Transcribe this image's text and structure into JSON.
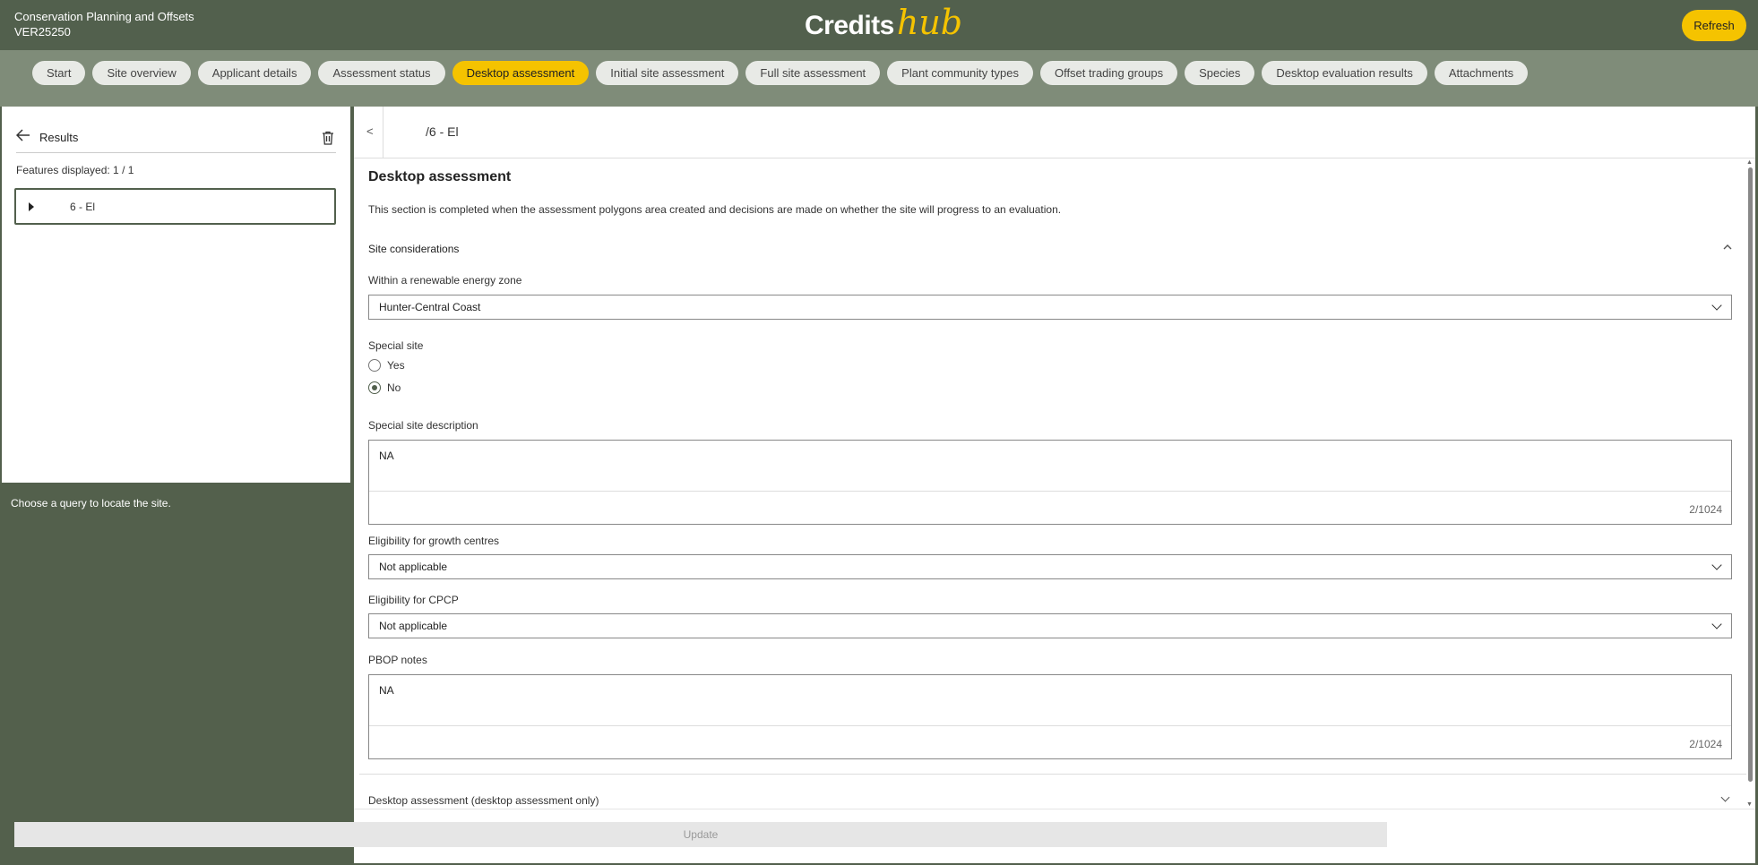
{
  "header": {
    "app_name": "Conservation Planning and Offsets",
    "record_id": "VER25250",
    "logo_credits": "Credits",
    "logo_hub": "hub",
    "refresh_label": "Refresh"
  },
  "tabs": [
    {
      "label": "Start",
      "active": false
    },
    {
      "label": "Site overview",
      "active": false
    },
    {
      "label": "Applicant details",
      "active": false
    },
    {
      "label": "Assessment status",
      "active": false
    },
    {
      "label": "Desktop assessment",
      "active": true
    },
    {
      "label": "Initial site assessment",
      "active": false
    },
    {
      "label": "Full site assessment",
      "active": false
    },
    {
      "label": "Plant community types",
      "active": false
    },
    {
      "label": "Offset trading groups",
      "active": false
    },
    {
      "label": "Species",
      "active": false
    },
    {
      "label": "Desktop evaluation results",
      "active": false
    },
    {
      "label": "Attachments",
      "active": false
    }
  ],
  "left_panel": {
    "results_label": "Results",
    "back_icon": "arrow-left-icon",
    "trash_icon": "trash-icon",
    "features_displayed": "Features displayed: 1 / 1",
    "feature_label": "6 - El",
    "note": "Choose a query to locate the site."
  },
  "main": {
    "back_label": "<",
    "top_title": "/6 - El",
    "section_title": "Desktop assessment",
    "section_desc": "This section is completed when the assessment polygons area created and decisions are made on whether the site will progress to an evaluation.",
    "site_considerations": "Site considerations",
    "renewable_label": "Within a renewable energy zone",
    "renewable_value": "Hunter-Central Coast",
    "special_site_label": "Special site",
    "radio_yes": "Yes",
    "radio_no": "No",
    "special_site_selected": "No",
    "special_desc_label": "Special site description",
    "special_desc_value": "NA",
    "special_desc_counter": "2/1024",
    "growth_label": "Eligibility for growth centres",
    "growth_value": "Not applicable",
    "cpcp_label": "Eligibility for CPCP",
    "cpcp_value": "Not applicable",
    "pbop_label": "PBOP notes",
    "pbop_value": "NA",
    "pbop_counter": "2/1024",
    "desktop_only": "Desktop assessment (desktop assessment only)",
    "update_label": "Update"
  },
  "colors": {
    "header_green": "#52604d",
    "tab_bar": "#7f8c79",
    "accent_yellow": "#f5c300"
  }
}
